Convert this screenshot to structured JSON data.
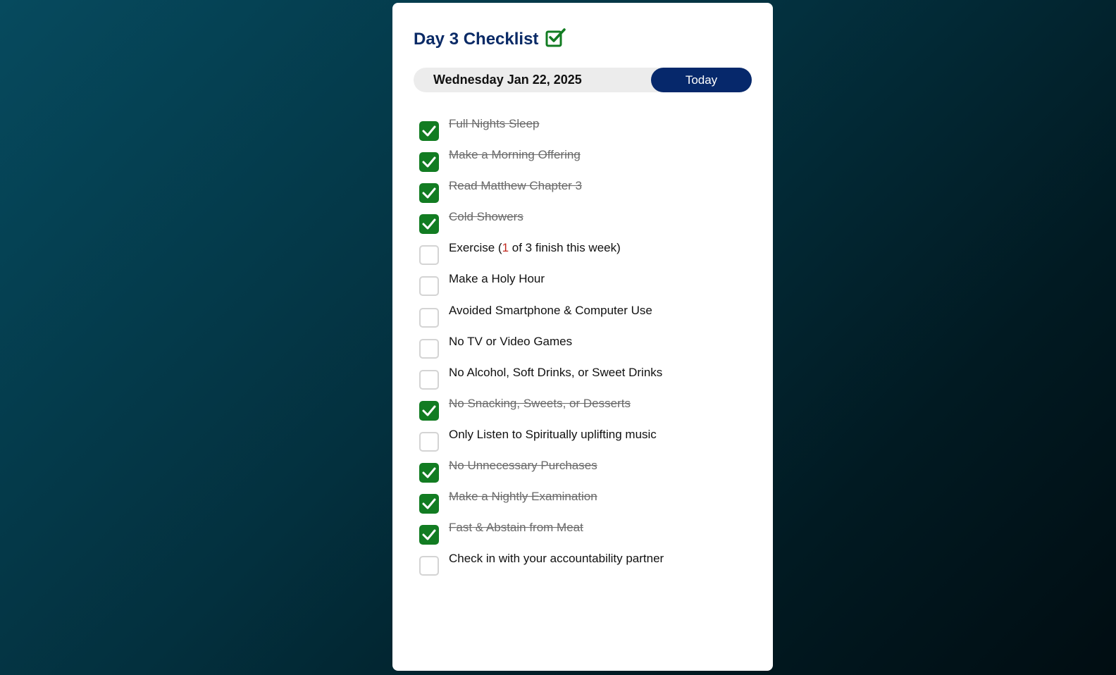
{
  "header": {
    "title": "Day 3 Checklist",
    "title_icon": "check-square-icon"
  },
  "date_bar": {
    "date": "Wednesday Jan 22, 2025",
    "today_label": "Today"
  },
  "colors": {
    "brand_navy": "#06286b",
    "check_green": "#127c22",
    "count_red": "#c0271d"
  },
  "items": [
    {
      "label": "Full Nights Sleep",
      "checked": true
    },
    {
      "label": "Make a Morning Offering",
      "checked": true
    },
    {
      "label": "Read Matthew Chapter 3",
      "checked": true
    },
    {
      "label": "Cold Showers",
      "checked": true
    },
    {
      "label_before": "Exercise (",
      "count": "1",
      "label_after": " of 3 finish this week)",
      "checked": false
    },
    {
      "label": "Make a Holy Hour",
      "checked": false
    },
    {
      "label": "Avoided Smartphone & Computer Use",
      "checked": false
    },
    {
      "label": "No TV or Video Games",
      "checked": false
    },
    {
      "label": "No Alcohol, Soft Drinks, or Sweet Drinks",
      "checked": false
    },
    {
      "label": "No Snacking, Sweets, or Desserts",
      "checked": true
    },
    {
      "label": "Only Listen to Spiritually uplifting music",
      "checked": false
    },
    {
      "label": "No Unnecessary Purchases",
      "checked": true
    },
    {
      "label": "Make a Nightly Examination",
      "checked": true
    },
    {
      "label": "Fast & Abstain from Meat",
      "checked": true
    },
    {
      "label": "Check in with your accountability partner",
      "checked": false
    }
  ]
}
